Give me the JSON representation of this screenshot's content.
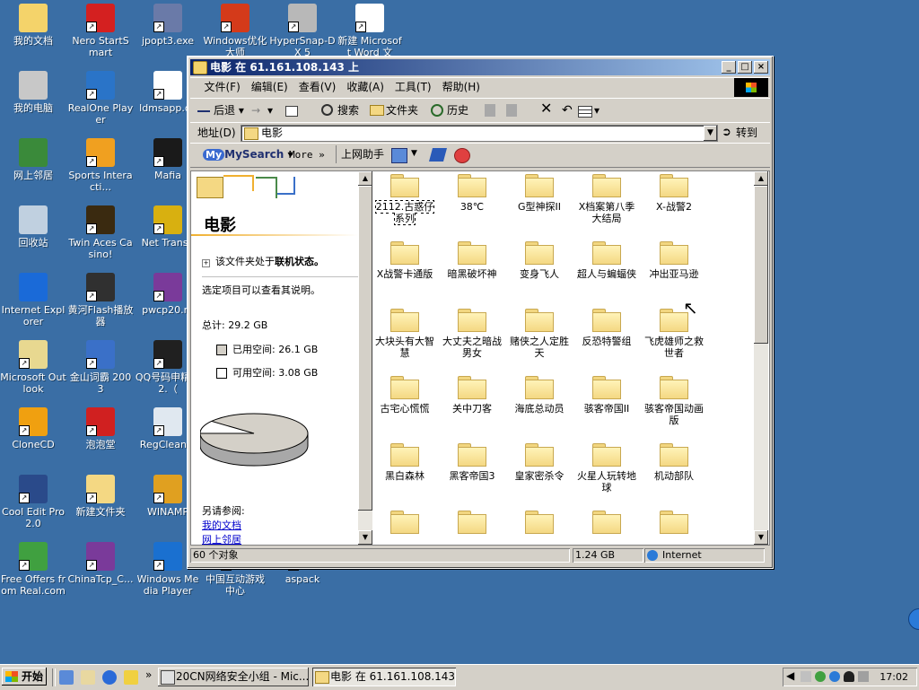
{
  "desktop": {
    "icons": [
      {
        "label": "我的文档",
        "icon": "my-documents-icon",
        "color": "#f4d36a"
      },
      {
        "label": "Nero StartSmart",
        "icon": "nero-icon",
        "color": "#d42020"
      },
      {
        "label": "jpopt3.exe",
        "icon": "jpopt-icon",
        "color": "#6a7aa8"
      },
      {
        "label": "Windows优化大师",
        "icon": "windows-optimizer-icon",
        "color": "#d43a1a"
      },
      {
        "label": "HyperSnap-DX 5",
        "icon": "hypersnap-icon",
        "color": "#b8b8b8"
      },
      {
        "label": "新建 Microsoft Word 文档....",
        "icon": "word-document-icon",
        "color": "#ffffff"
      },
      {
        "label": "我的电脑",
        "icon": "my-computer-icon",
        "color": "#c8c8c8"
      },
      {
        "label": "RealOne Player",
        "icon": "realone-icon",
        "color": "#2a74c8"
      },
      {
        "label": "ldmsapp.dc",
        "icon": "word-file-icon",
        "color": "#ffffff"
      },
      {
        "label": "网上邻居",
        "icon": "network-icon",
        "color": "#3a8a3a"
      },
      {
        "label": "Sports Interacti...",
        "icon": "sports-icon",
        "color": "#f0a020"
      },
      {
        "label": "Mafia",
        "icon": "mafia-icon",
        "color": "#1a1a1a"
      },
      {
        "label": "回收站",
        "icon": "recycle-bin-icon",
        "color": "#c0d0e0"
      },
      {
        "label": "Twin Aces Casino!",
        "icon": "twin-aces-icon",
        "color": "#3a2a10"
      },
      {
        "label": "Net Transp",
        "icon": "net-transport-icon",
        "color": "#d8b010"
      },
      {
        "label": "Internet Explorer",
        "icon": "internet-explorer-icon",
        "color": "#1a6ad8"
      },
      {
        "label": "黄河Flash播放器",
        "icon": "flash-player-icon",
        "color": "#303030"
      },
      {
        "label": "pwcp20.ra",
        "icon": "winrar-archive-icon",
        "color": "#7a3a9a"
      },
      {
        "label": "Microsoft Outlook",
        "icon": "outlook-icon",
        "color": "#e8d890"
      },
      {
        "label": "金山词霸 2003",
        "icon": "kingsoft-icon",
        "color": "#3a70c8"
      },
      {
        "label": "QQ号码申精灵 2.（",
        "icon": "qq-icon",
        "color": "#202020"
      },
      {
        "label": "CloneCD",
        "icon": "clonecd-icon",
        "color": "#f0a010"
      },
      {
        "label": "泡泡堂",
        "icon": "joystick-icon",
        "color": "#d02020"
      },
      {
        "label": "RegClean.e",
        "icon": "regclean-icon",
        "color": "#e0e8f0"
      },
      {
        "label": "Cool Edit Pro 2.0",
        "icon": "cool-edit-icon",
        "color": "#2a4a8a"
      },
      {
        "label": "新建文件夹",
        "icon": "folder-icon",
        "color": "#f4d883"
      },
      {
        "label": "WINAMP",
        "icon": "winamp-icon",
        "color": "#e0a020"
      },
      {
        "label": "Free Offers from Real.com",
        "icon": "gift-icon",
        "color": "#40a040"
      },
      {
        "label": "ChinaTcp_C...",
        "icon": "winrar-archive-icon",
        "color": "#7a3a9a"
      },
      {
        "label": "Windows Media Player",
        "icon": "media-player-icon",
        "color": "#1a70d0"
      },
      {
        "label": "中国互动游戏中心",
        "icon": "game-center-icon",
        "color": "#3a6ea5"
      },
      {
        "label": "aspack",
        "icon": "aspack-icon",
        "color": "#3a6ea5"
      }
    ]
  },
  "window": {
    "title": "电影 在 61.161.108.143 上",
    "menu": [
      "文件(F)",
      "编辑(E)",
      "查看(V)",
      "收藏(A)",
      "工具(T)",
      "帮助(H)"
    ],
    "toolbar": {
      "back": "后退",
      "search": "搜索",
      "folders": "文件夹",
      "history": "历史"
    },
    "address": {
      "label": "地址(D)",
      "value": "电影",
      "go": "转到"
    },
    "links": {
      "mysearch": "MySearch",
      "more": "More",
      "assistant": "上网助手"
    },
    "left_pane": {
      "folder_name": "电影",
      "offline_prefix": "该文件夹处于",
      "offline_bold": "联机状态。",
      "hint": "选定项目可以查看其说明。",
      "total": "总计: 29.2 GB",
      "used": "已用空间: 26.1 GB",
      "free": "可用空间: 3.08 GB",
      "see_also": "另请参阅:",
      "link1": "我的文档",
      "link2": "网上邻居"
    },
    "disk_usage": {
      "used_gb": 26.1,
      "free_gb": 3.08,
      "used_color": "#d4d0c8",
      "free_color": "#ffffff"
    },
    "folders": [
      "2112.古惑仔系列",
      "38℃",
      "G型神探II",
      "X档案第八季大结局",
      "X-战警2",
      "X战警卡通版",
      "暗黑破坏神",
      "变身飞人",
      "超人与蝙蝠侠",
      "冲出亚马逊",
      "大块头有大智慧",
      "大丈夫之暗战男女",
      "赌侠之人定胜天",
      "反恐特警组",
      "飞虎雄师之救世者",
      "古宅心慌慌",
      "关中刀客",
      "海底总动员",
      "骇客帝国II",
      "骇客帝国动画版",
      "黑白森林",
      "黑客帝国3",
      "皇家密杀令",
      "火星人玩转地球",
      "机动部队",
      "",
      "",
      "",
      "",
      ""
    ],
    "status": {
      "count": "60 个对象",
      "size": "1.24 GB",
      "zone": "Internet"
    }
  },
  "taskbar": {
    "start": "开始",
    "tasks": [
      "20CN网络安全小组 - Mic...",
      "电影 在 61.161.108.143 上"
    ],
    "clock": "17:02"
  }
}
